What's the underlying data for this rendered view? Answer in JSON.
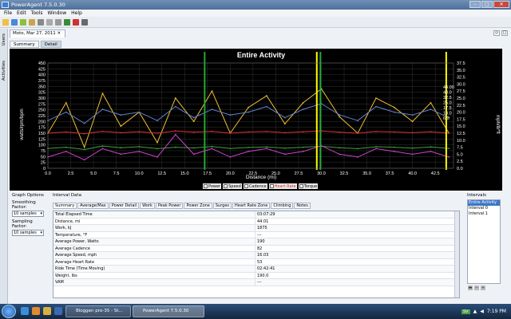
{
  "window": {
    "title": "PowerAgent 7.5.0.30"
  },
  "menu": [
    "File",
    "Edit",
    "Tools",
    "Window",
    "Help"
  ],
  "sidebar": {
    "users_label": "Users",
    "activities_label": "Activities"
  },
  "document_tab": {
    "label": "Moto, Mar 27, 2011"
  },
  "sub_tabs": [
    {
      "label": "Summary",
      "active": false
    },
    {
      "label": "Detail",
      "active": true
    }
  ],
  "chart": {
    "title": "Entire Activity",
    "y_left_label": "watts/rpm/bpm",
    "y_right_label": "mph/lb*ft",
    "x_label": "Distance (mi)",
    "annotation": [
      "44.00",
      "40.0",
      "32.5",
      "25.0",
      "17.5",
      "10.0",
      "6.0"
    ]
  },
  "chart_data": {
    "type": "line",
    "title": "Entire Activity",
    "xlabel": "Distance (mi)",
    "ylabel": "watts/rpm/bpm",
    "ylabel_right": "mph/lb*ft",
    "xlim": [
      0,
      44.5
    ],
    "ylim": [
      0,
      450
    ],
    "ylim_right": [
      0,
      37.5
    ],
    "x_ticks": [
      "0.0",
      "2.5",
      "5.0",
      "7.5",
      "10.0",
      "12.5",
      "15.0",
      "17.5",
      "20.0",
      "22.5",
      "25.0",
      "27.5",
      "30.0",
      "32.5",
      "35.0",
      "37.5",
      "40.0",
      "42.5"
    ],
    "y_ticks": [
      "0",
      "25",
      "50",
      "75",
      "100",
      "125",
      "150",
      "175",
      "200",
      "225",
      "250",
      "275",
      "300",
      "325",
      "350",
      "375",
      "400",
      "425",
      "450"
    ],
    "y_ticks_right": [
      "0.0",
      "2.5",
      "5.0",
      "7.5",
      "10.0",
      "12.5",
      "15.0",
      "17.5",
      "20.0",
      "22.5",
      "25.0",
      "27.5",
      "30.0",
      "32.5",
      "35.0",
      "37.5"
    ],
    "markers": [
      {
        "x": 17.2,
        "color": "#22aa33"
      },
      {
        "x": 29.5,
        "color": "#ffff00"
      },
      {
        "x": 29.9,
        "color": "#22aa33"
      },
      {
        "x": 43.7,
        "color": "#ffff00"
      }
    ],
    "series": [
      {
        "name": "Power",
        "color": "#f0c030",
        "x": [
          0,
          2,
          4,
          6,
          8,
          10,
          12,
          14,
          16,
          18,
          20,
          22,
          24,
          26,
          28,
          30,
          32,
          34,
          36,
          38,
          40,
          42,
          44
        ],
        "values": [
          150,
          280,
          90,
          320,
          180,
          240,
          110,
          300,
          200,
          330,
          150,
          260,
          310,
          190,
          280,
          340,
          220,
          150,
          300,
          260,
          200,
          280,
          150
        ]
      },
      {
        "name": "Speed",
        "color": "#6080d0",
        "x": [
          0,
          2,
          4,
          6,
          8,
          10,
          12,
          14,
          16,
          18,
          20,
          22,
          24,
          26,
          28,
          30,
          32,
          34,
          36,
          38,
          40,
          42,
          44
        ],
        "values": [
          17,
          20,
          16,
          21,
          19,
          20,
          17,
          22,
          18,
          21,
          19,
          20,
          22,
          18,
          21,
          23,
          19,
          17,
          22,
          20,
          19,
          21,
          18
        ]
      },
      {
        "name": "Cadence",
        "color": "#40a040",
        "x": [
          0,
          2,
          4,
          6,
          8,
          10,
          12,
          14,
          16,
          18,
          20,
          22,
          24,
          26,
          28,
          30,
          32,
          34,
          36,
          38,
          40,
          42,
          44
        ],
        "values": [
          85,
          90,
          80,
          95,
          88,
          92,
          84,
          90,
          87,
          93,
          85,
          89,
          91,
          86,
          90,
          94,
          88,
          84,
          92,
          90,
          86,
          91,
          85
        ]
      },
      {
        "name": "Heart Rate",
        "color": "#e03030",
        "x": [
          0,
          2,
          4,
          6,
          8,
          10,
          12,
          14,
          16,
          18,
          20,
          22,
          24,
          26,
          28,
          30,
          32,
          34,
          36,
          38,
          40,
          42,
          44
        ],
        "values": [
          150,
          155,
          148,
          158,
          152,
          156,
          150,
          160,
          154,
          158,
          150,
          155,
          157,
          152,
          156,
          160,
          154,
          150,
          157,
          155,
          152,
          156,
          150
        ]
      },
      {
        "name": "Torque",
        "color": "#d040d0",
        "x": [
          0,
          2,
          4,
          6,
          8,
          10,
          12,
          14,
          16,
          18,
          20,
          22,
          24,
          26,
          28,
          30,
          32,
          34,
          36,
          38,
          40,
          42,
          44
        ],
        "values": [
          4,
          6,
          3,
          7,
          5,
          6,
          4,
          12,
          5,
          7,
          4,
          6,
          7,
          5,
          6,
          8,
          5,
          4,
          7,
          6,
          5,
          6,
          4
        ]
      }
    ]
  },
  "graph_options": {
    "title": "Graph Options",
    "smoothing_label": "Smoothing Factor:",
    "smoothing_value": "10 samples",
    "sampling_label": "Sampling Factor:",
    "sampling_value": "10 samples"
  },
  "interval_data": {
    "title": "Interval Data",
    "tabs": [
      "Summary",
      "Average/Max",
      "Power Detail",
      "Work",
      "Peak Power",
      "Power Zone",
      "Surges",
      "Heart Rate Zone",
      "Climbing",
      "Notes"
    ],
    "rows": [
      {
        "k": "Total Elapsed Time",
        "v": "03:07:29"
      },
      {
        "k": "Distance, mi",
        "v": "44.01"
      },
      {
        "k": "Work, kJ",
        "v": "1875"
      },
      {
        "k": "Temperature, °F",
        "v": "---"
      },
      {
        "k": "Average Power, Watts",
        "v": "190"
      },
      {
        "k": "Average Cadence",
        "v": "82"
      },
      {
        "k": "Average Speed, mph",
        "v": "16.03"
      },
      {
        "k": "Average Heart Rate",
        "v": "53"
      },
      {
        "k": "Ride Time (Time Moving)",
        "v": "02:42:41"
      },
      {
        "k": "Weight, lbs",
        "v": "190.0"
      },
      {
        "k": "VAM",
        "v": "---"
      }
    ]
  },
  "intervals": {
    "title": "Intervals",
    "items": [
      {
        "label": "Entire Activity",
        "selected": true
      },
      {
        "label": "Interval 0",
        "selected": false
      },
      {
        "label": "Interval 1",
        "selected": false
      }
    ]
  },
  "taskbar": {
    "tasks": [
      {
        "label": "Bloggen pro-35 - St...",
        "active": false
      },
      {
        "label": "PowerAgent 7.5.0.30",
        "active": true
      }
    ],
    "lang": "SV",
    "clock": "7:19 PM"
  }
}
